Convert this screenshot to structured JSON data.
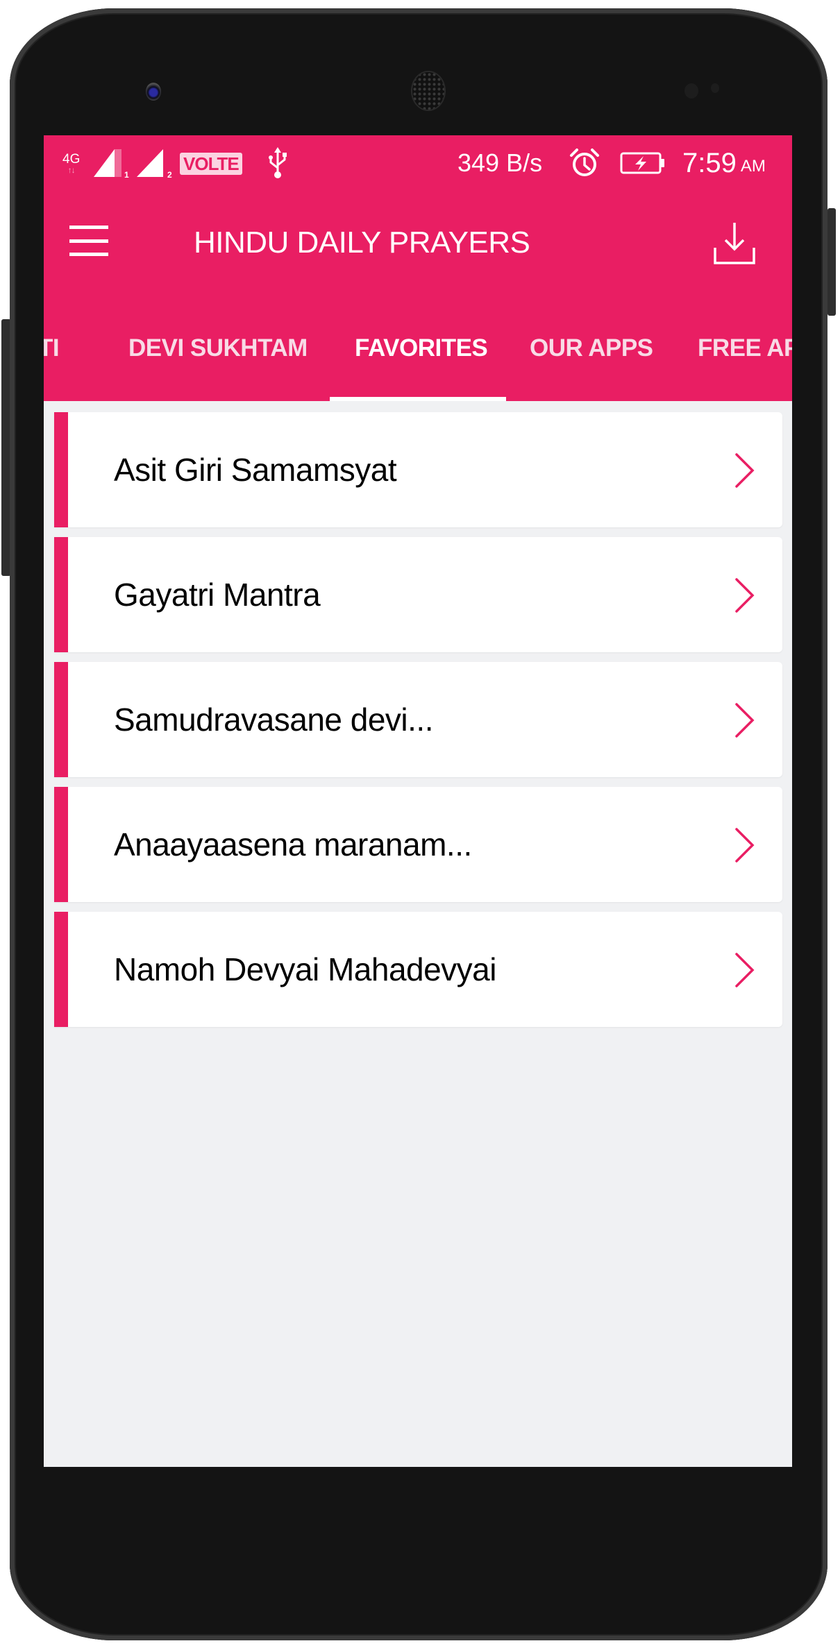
{
  "status_bar": {
    "network_type": "4G",
    "sim1_label": "1",
    "sim2_label": "2",
    "volte_label": "VOLTE",
    "network_speed": "349 B/s",
    "time": "7:59",
    "ampm": "AM",
    "icons": [
      "4g-data-icon",
      "signal-sim1-icon",
      "signal-sim2-icon",
      "volte-badge",
      "usb-icon",
      "alarm-icon",
      "battery-charging-icon"
    ]
  },
  "toolbar": {
    "title": "HINDU DAILY PRAYERS",
    "menu_icon": "hamburger-menu-icon",
    "action_icon": "download-icon"
  },
  "tabs": [
    {
      "label": "TI",
      "active": false
    },
    {
      "label": "DEVI SUKHTAM",
      "active": false
    },
    {
      "label": "FAVORITES",
      "active": true
    },
    {
      "label": "OUR APPS",
      "active": false
    },
    {
      "label": "FREE AP",
      "active": false
    }
  ],
  "favorites": [
    {
      "title": "Asit Giri Samamsyat"
    },
    {
      "title": "Gayatri Mantra"
    },
    {
      "title": "Samudravasane devi..."
    },
    {
      "title": "Anaayaasena maranam..."
    },
    {
      "title": "Namoh Devyai Mahadevyai"
    }
  ],
  "colors": {
    "accent": "#e91e63",
    "background": "#f0f1f3",
    "card": "#ffffff",
    "text": "#000000"
  }
}
